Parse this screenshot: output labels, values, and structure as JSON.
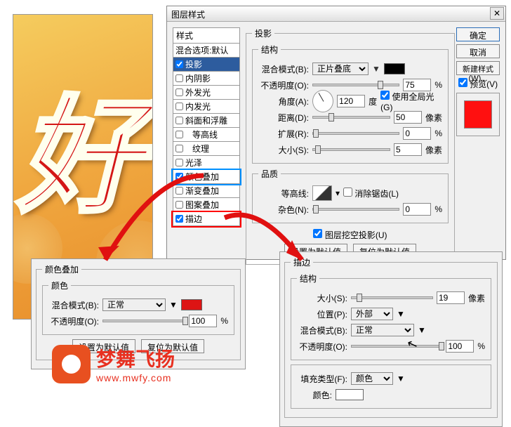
{
  "preview": {
    "char": "好"
  },
  "dialog": {
    "title": "图层样式",
    "close": "✕"
  },
  "styles": {
    "header": "样式",
    "items": [
      {
        "label": "混合选项:默认",
        "checked": false,
        "nochk": true
      },
      {
        "label": "投影",
        "checked": true,
        "sel": true
      },
      {
        "label": "内阴影",
        "checked": false
      },
      {
        "label": "外发光",
        "checked": false
      },
      {
        "label": "内发光",
        "checked": false
      },
      {
        "label": "斜面和浮雕",
        "checked": false
      },
      {
        "label": "等高线",
        "checked": false,
        "indent": true
      },
      {
        "label": "纹理",
        "checked": false,
        "indent": true
      },
      {
        "label": "光泽",
        "checked": false
      },
      {
        "label": "颜色叠加",
        "checked": true,
        "hl": "blue"
      },
      {
        "label": "渐变叠加",
        "checked": false
      },
      {
        "label": "图案叠加",
        "checked": false
      },
      {
        "label": "描边",
        "checked": true,
        "hl": "red"
      }
    ]
  },
  "shadow": {
    "group_title": "投影",
    "struct": "结构",
    "blend_label": "混合模式(B):",
    "blend_val": "正片叠底",
    "swatch": "#000000",
    "opacity_label": "不透明度(O):",
    "opacity_val": "75",
    "pct": "%",
    "angle_label": "角度(A):",
    "angle_val": "120",
    "deg": "度",
    "global": "使用全局光(G)",
    "dist_label": "距离(D):",
    "dist_val": "50",
    "px": "像素",
    "spread_label": "扩展(R):",
    "spread_val": "0",
    "size_label": "大小(S):",
    "size_val": "5",
    "quality": "品质",
    "contour_label": "等高线:",
    "antialias": "消除锯齿(L)",
    "noise_label": "杂色(N):",
    "noise_val": "0",
    "knockout": "图层挖空投影(U)",
    "set_default": "设置为默认值",
    "reset_default": "复位为默认值"
  },
  "buttons": {
    "ok": "确定",
    "cancel": "取消",
    "new_style": "新建样式(W)...",
    "preview": "预览(V)"
  },
  "overlay": {
    "title": "颜色叠加",
    "color": "颜色",
    "blend_label": "混合模式(B):",
    "blend_val": "正常",
    "swatch": "#dd1414",
    "opacity_label": "不透明度(O):",
    "opacity_val": "100",
    "pct": "%",
    "set_default": "设置为默认值",
    "reset_default": "复位为默认值"
  },
  "stroke": {
    "title": "描边",
    "struct": "结构",
    "size_label": "大小(S):",
    "size_val": "19",
    "px": "像素",
    "pos_label": "位置(P):",
    "pos_val": "外部",
    "blend_label": "混合模式(B):",
    "blend_val": "正常",
    "opacity_label": "不透明度(O):",
    "opacity_val": "100",
    "pct": "%",
    "fill_label": "填充类型(F):",
    "fill_val": "颜色",
    "color_label": "颜色:"
  },
  "logo": {
    "text": "梦舞飞扬",
    "url": "www.mwfy.com"
  }
}
